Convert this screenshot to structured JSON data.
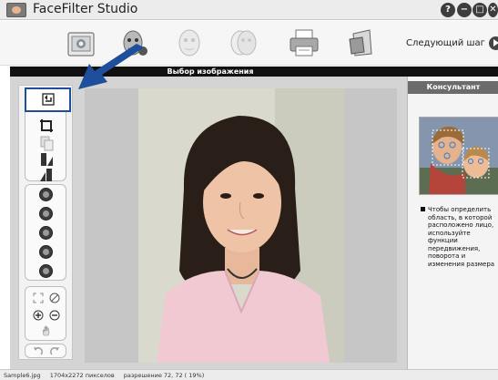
{
  "window": {
    "title": "FaceFilter Studio",
    "buttons": [
      "?",
      "−",
      "□",
      "✕"
    ]
  },
  "toolbar": {
    "steps": [
      {
        "name": "select-image",
        "icon": "folder-photo-icon",
        "active": true
      },
      {
        "name": "face-detect",
        "icon": "face-detect-icon",
        "active": true
      },
      {
        "name": "face-edit",
        "icon": "face-edit-icon",
        "active": false
      },
      {
        "name": "face-effects",
        "icon": "face-effects-icon",
        "active": false
      },
      {
        "name": "print",
        "icon": "printer-icon",
        "active": true
      },
      {
        "name": "export",
        "icon": "export-icon",
        "active": true
      }
    ],
    "next_step_label": "Следующий шаг"
  },
  "section": {
    "title": "Выбор изображения"
  },
  "tools": {
    "group1": [
      "rotate-left-icon",
      "crop-icon",
      "copy-icon",
      "flip-horizontal-icon",
      "flip-vertical-icon"
    ],
    "group2": [
      "adjust-brightness-icon",
      "adjust-contrast-icon",
      "adjust-color-icon",
      "adjust-saturation-icon",
      "reset-icon"
    ],
    "group3": [
      "fit-to-window-icon",
      "no-zoom-icon",
      "zoom-in-icon",
      "zoom-out-icon",
      "hand-pan-icon"
    ],
    "undo_redo": [
      "undo-icon",
      "redo-icon"
    ]
  },
  "consultant": {
    "title": "Консультант",
    "help_text": "Чтобы определить область, в которой расположено лицо, используйте функции передвижения, поворота и изменения размера"
  },
  "status": {
    "filename": "Sample6.jpg",
    "dimensions": "1704x2272 пикселов",
    "resolution": "разрешение 72, 72 ( 19%)"
  },
  "colors": {
    "accent": "#1e4f9c",
    "header_bar": "#111111",
    "panel_title": "#6b6b6b"
  }
}
